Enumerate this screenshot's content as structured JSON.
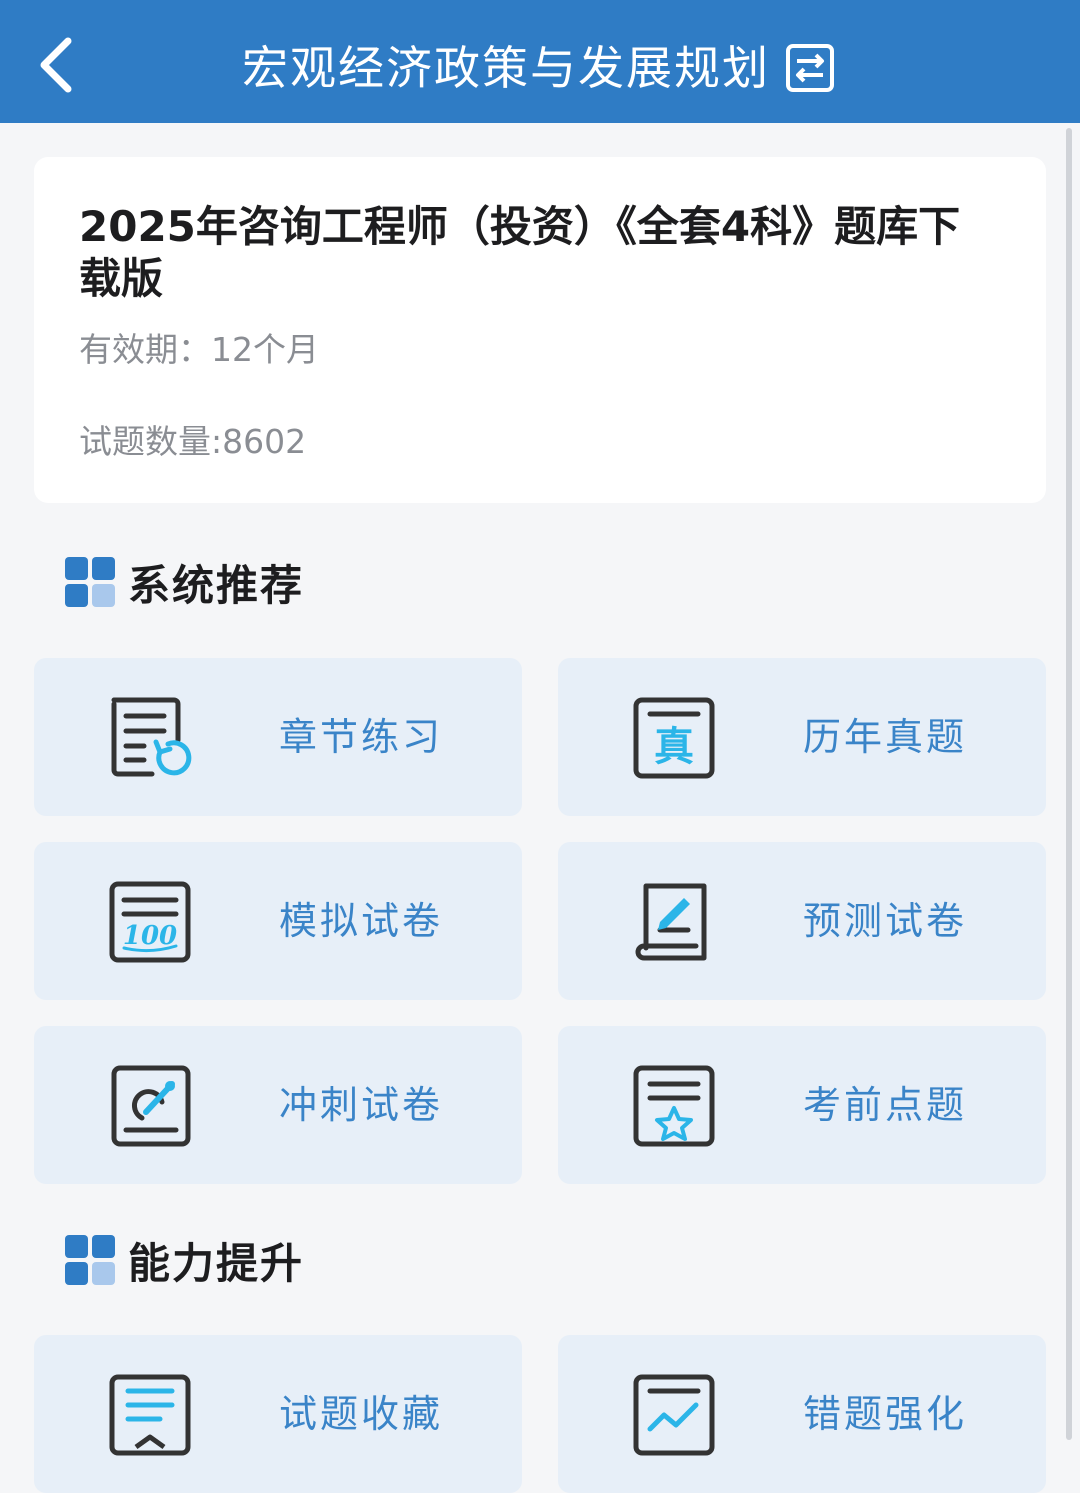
{
  "header": {
    "title": "宏观经济政策与发展规划",
    "back_icon": "chevron-left-icon",
    "switch_icon": "switch-icon"
  },
  "product": {
    "title": "2025年咨询工程师（投资）《全套4科》题库下载版",
    "validity": "有效期：12个月",
    "question_count": "试题数量:8602"
  },
  "sections": [
    {
      "title": "系统推荐",
      "items": [
        {
          "label": "章节练习",
          "icon": "chapter-practice-icon"
        },
        {
          "label": "历年真题",
          "icon": "past-exam-icon"
        },
        {
          "label": "模拟试卷",
          "icon": "mock-exam-icon"
        },
        {
          "label": "预测试卷",
          "icon": "prediction-exam-icon"
        },
        {
          "label": "冲刺试卷",
          "icon": "sprint-exam-icon"
        },
        {
          "label": "考前点题",
          "icon": "key-points-icon"
        }
      ]
    },
    {
      "title": "能力提升",
      "items": [
        {
          "label": "试题收藏",
          "icon": "favorites-icon"
        },
        {
          "label": "错题强化",
          "icon": "wrong-questions-icon"
        }
      ]
    }
  ],
  "colors": {
    "header_bg": "#2f7cc5",
    "tile_bg": "#e7eff8",
    "tile_text": "#3a84c8",
    "page_bg": "#f5f6f8"
  }
}
